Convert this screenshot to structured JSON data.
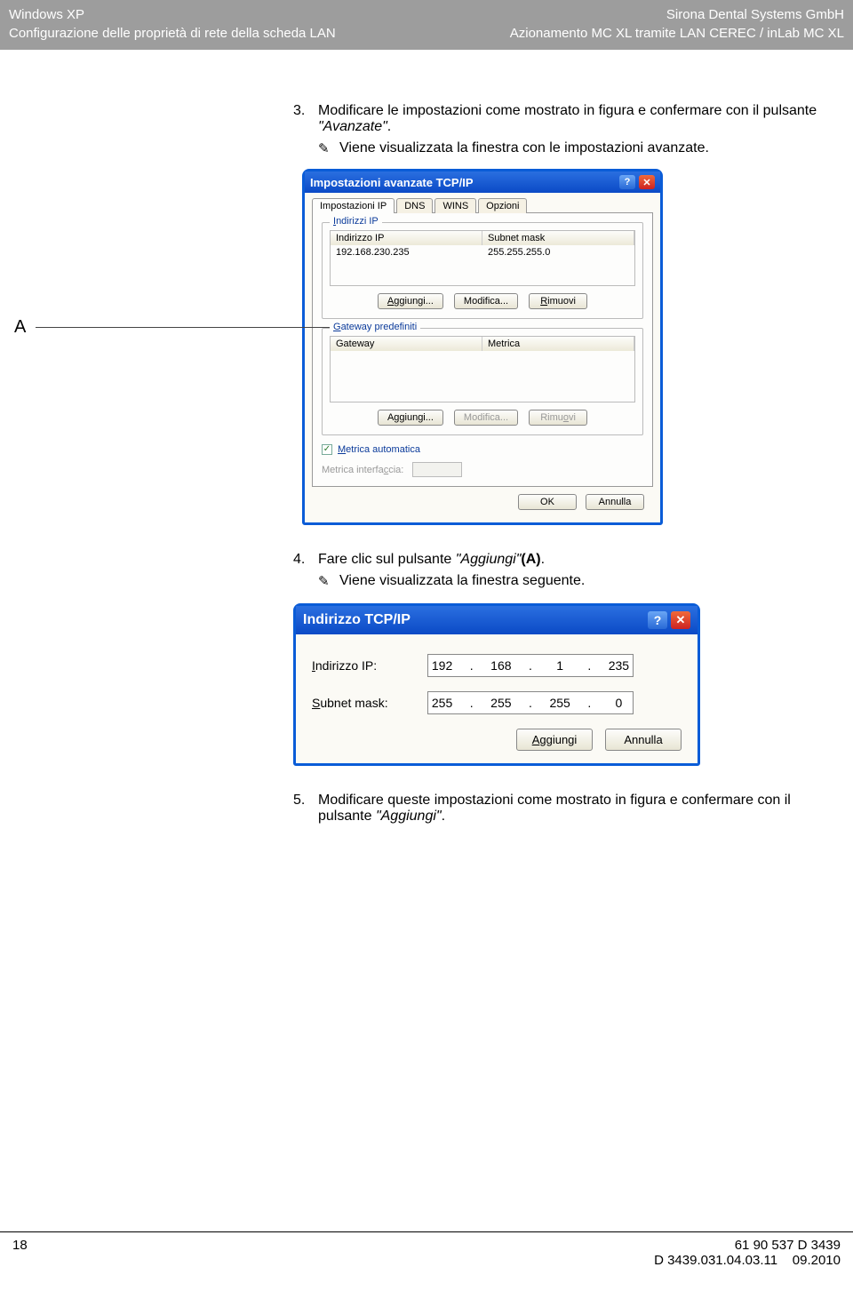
{
  "header": {
    "left_top": "Windows XP",
    "left_bottom": "Configurazione delle proprietà di rete della scheda LAN",
    "right_top": "Sirona Dental Systems GmbH",
    "right_bottom": "Azionamento MC XL tramite LAN CEREC / inLab MC XL"
  },
  "step3_num": "3.",
  "step3_a": "Modificare le impostazioni come mostrato in figura e confermare con il pulsante ",
  "step3_b": "\"Avanzate\"",
  "step3_c": ".",
  "res3": "Viene visualizzata la finestra con le impostazioni avanzate.",
  "A_label": "A",
  "dlg1": {
    "title": "Impostazioni avanzate TCP/IP",
    "tabs": {
      "t1": "Impostazioni IP",
      "t2": "DNS",
      "t3": "WINS",
      "t4": "Opzioni"
    },
    "grp_ip": "Indirizzi IP",
    "col_ip": "Indirizzo IP",
    "col_mask": "Subnet mask",
    "val_ip": "192.168.230.235",
    "val_mask": "255.255.255.0",
    "btn_add": "Aggiungi...",
    "btn_mod": "Modifica...",
    "btn_rem": "Rimuovi",
    "grp_gw": "Gateway predefiniti",
    "col_gw": "Gateway",
    "col_metric": "Metrica",
    "chk": "Metrica automatica",
    "metric_if": "Metrica interfaccia:",
    "ok": "OK",
    "cancel": "Annulla"
  },
  "step4_num": "4.",
  "step4_a": "Fare clic sul pulsante ",
  "step4_b": "\"Aggiungi\"",
  "step4_c": "(A)",
  "step4_d": ".",
  "res4": "Viene visualizzata la finestra seguente.",
  "dlg2": {
    "title": "Indirizzo TCP/IP",
    "lbl_ip": "Indirizzo IP:",
    "lbl_mask": "Subnet mask:",
    "ip": {
      "a": "192",
      "b": "168",
      "c": "1",
      "d": "235"
    },
    "mask": {
      "a": "255",
      "b": "255",
      "c": "255",
      "d": "0"
    },
    "btn_add": "Aggiungi",
    "btn_cancel": "Annulla"
  },
  "step5_num": "5.",
  "step5_a": "Modificare queste impostazioni come mostrato in figura e confermare con il pulsante ",
  "step5_b": "\"Aggiungi\"",
  "step5_c": ".",
  "footer": {
    "page": "18",
    "code1": "61 90 537 D 3439",
    "code2": "D 3439.031.04.03.11",
    "date": "09.2010"
  }
}
